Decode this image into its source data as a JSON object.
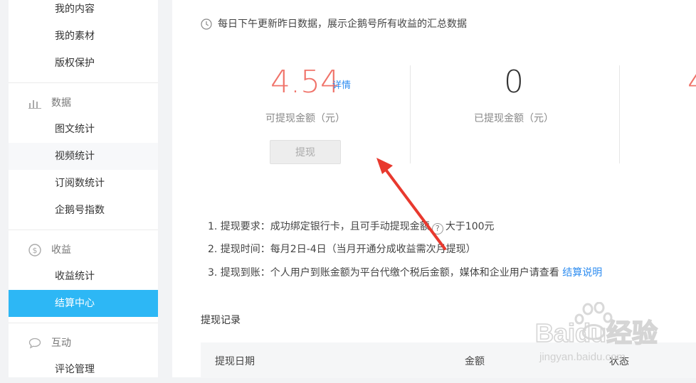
{
  "sidebar": {
    "items_top": [
      {
        "label": "我的内容"
      },
      {
        "label": "我的素材"
      },
      {
        "label": "版权保护"
      }
    ],
    "group_data": {
      "label": "数据",
      "icon": "bar-chart-icon"
    },
    "items_data": [
      {
        "label": "图文统计"
      },
      {
        "label": "视频统计"
      },
      {
        "label": "订阅数统计"
      },
      {
        "label": "企鹅号指数"
      }
    ],
    "group_income": {
      "label": "收益",
      "icon": "dollar-circle-icon"
    },
    "items_income": [
      {
        "label": "收益统计"
      },
      {
        "label": "结算中心"
      }
    ],
    "group_interact": {
      "label": "互动",
      "icon": "speech-bubble-icon"
    },
    "items_interact": [
      {
        "label": "评论管理"
      }
    ],
    "active_item": "结算中心"
  },
  "main": {
    "notice": "每日下午更新昨日数据，展示企鹅号所有收益的汇总数据",
    "stats": [
      {
        "value": "4.54",
        "label": "可提现金额（元）",
        "link": "详情",
        "color": "#f0736a"
      },
      {
        "value": "0",
        "label": "已提现金额（元）",
        "color": "#333333"
      },
      {
        "value": "4",
        "color": "#f0736a"
      }
    ],
    "withdraw_button": "提现",
    "rules": {
      "r1_text": "1. 提现要求：成功绑定银行卡，且可手动提现金额",
      "r1_help": "?",
      "r1_tail": "大于100元",
      "r2_text": "2. 提现时间：每月2日-4日（当月开通分成收益需次月提现）",
      "r3_text": "3. 提现到账：个人用户到账金额为平台代缴个税后金额，媒体和企业用户请查看",
      "r3_link": "结算说明"
    },
    "records": {
      "title": "提现记录",
      "columns": [
        "提现日期",
        "金额",
        "状态"
      ]
    }
  },
  "watermark": {
    "logo": "Baidu经验",
    "url": "jingyan.baidu.com"
  }
}
